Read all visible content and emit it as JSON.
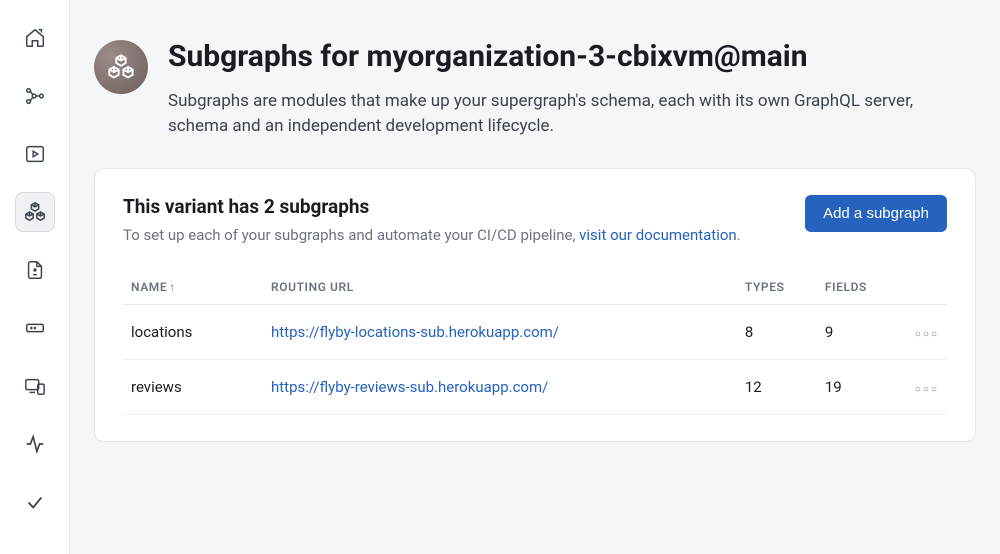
{
  "page": {
    "title": "Subgraphs for myorganization-3-cbixvm@main",
    "description": "Subgraphs are modules that make up your supergraph's schema, each with its own GraphQL server, schema and an independent development lifecycle."
  },
  "card": {
    "title": "This variant has 2 subgraphs",
    "subtext_prefix": "To set up each of your subgraphs and automate your CI/CD pipeline, ",
    "subtext_link": "visit our documentation",
    "subtext_suffix": ".",
    "add_button": "Add a subgraph"
  },
  "table": {
    "headers": {
      "name": "NAME",
      "url": "ROUTING URL",
      "types": "TYPES",
      "fields": "FIELDS"
    },
    "rows": [
      {
        "name": "locations",
        "url": "https://flyby-locations-sub.herokuapp.com/",
        "types": "8",
        "fields": "9"
      },
      {
        "name": "reviews",
        "url": "https://flyby-reviews-sub.herokuapp.com/",
        "types": "12",
        "fields": "19"
      }
    ]
  }
}
